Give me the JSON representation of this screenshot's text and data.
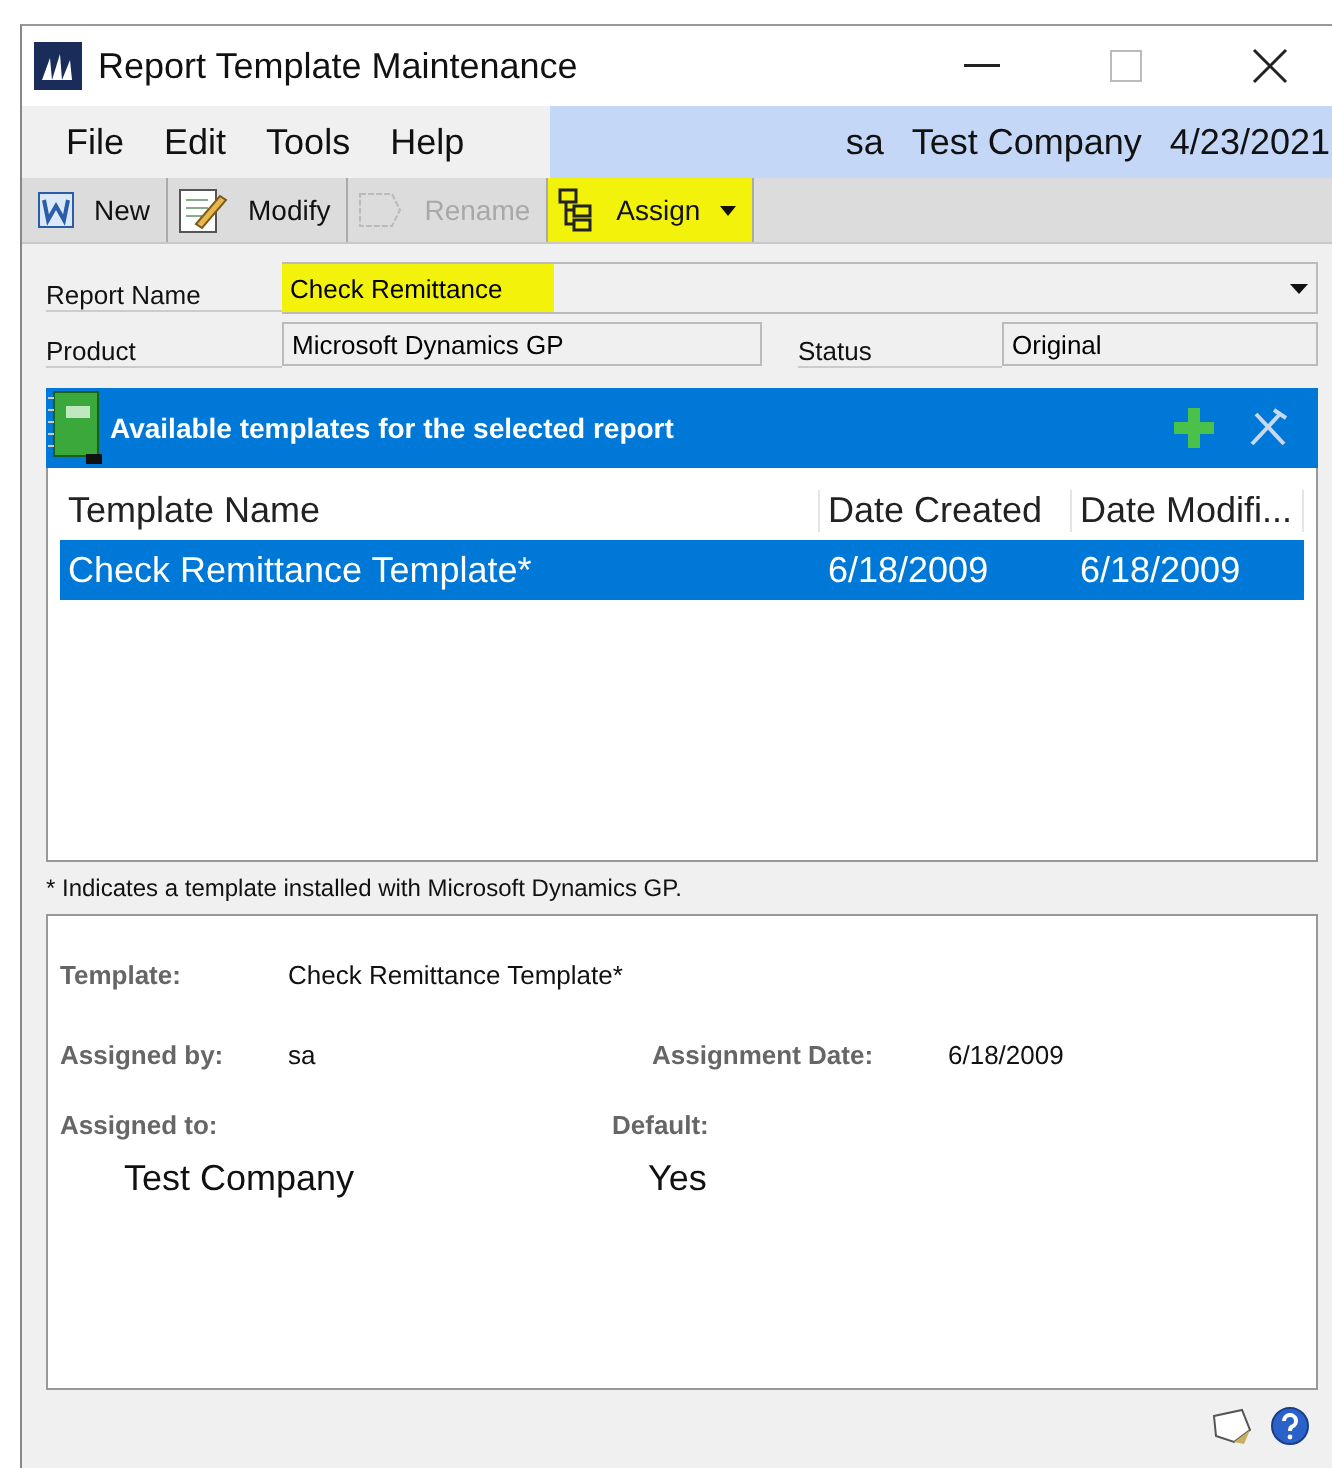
{
  "window": {
    "title": "Report Template Maintenance"
  },
  "menu": [
    "File",
    "Edit",
    "Tools",
    "Help"
  ],
  "session": {
    "user": "sa",
    "company": "Test Company",
    "date": "4/23/2021"
  },
  "toolbar": [
    {
      "kind": "word",
      "label": "New",
      "disabled": false,
      "highlighted": false
    },
    {
      "kind": "modify",
      "label": "Modify",
      "disabled": false,
      "highlighted": false
    },
    {
      "kind": "rename",
      "label": "Rename",
      "disabled": true,
      "highlighted": false
    },
    {
      "kind": "assign",
      "label": "Assign",
      "disabled": false,
      "highlighted": true
    }
  ],
  "report_name": {
    "label": "Report Name",
    "value": "Check Remittance",
    "highlighted": true
  },
  "product": {
    "label": "Product",
    "value": "Microsoft Dynamics GP"
  },
  "status": {
    "label": "Status",
    "value": "Original"
  },
  "templates": {
    "title": "Available templates for the selected report",
    "columns": [
      "Template Name",
      "Date Created",
      "Date Modifi..."
    ],
    "rows": [
      {
        "cells": [
          "Check Remittance Template*",
          "6/18/2009",
          "6/18/2009"
        ],
        "selected": true
      }
    ]
  },
  "footnote": "* Indicates a template installed with Microsoft Dynamics GP.",
  "details": {
    "template_label": "Template:",
    "template": "Check Remittance Template*",
    "assigned_by_label": "Assigned by:",
    "assigned_by": "sa",
    "assignment_date_label": "Assignment Date:",
    "assignment_date": "6/18/2009",
    "assigned_to_label": "Assigned to:",
    "assigned_to": "Test Company",
    "default_label": "Default:",
    "default": "Yes"
  }
}
